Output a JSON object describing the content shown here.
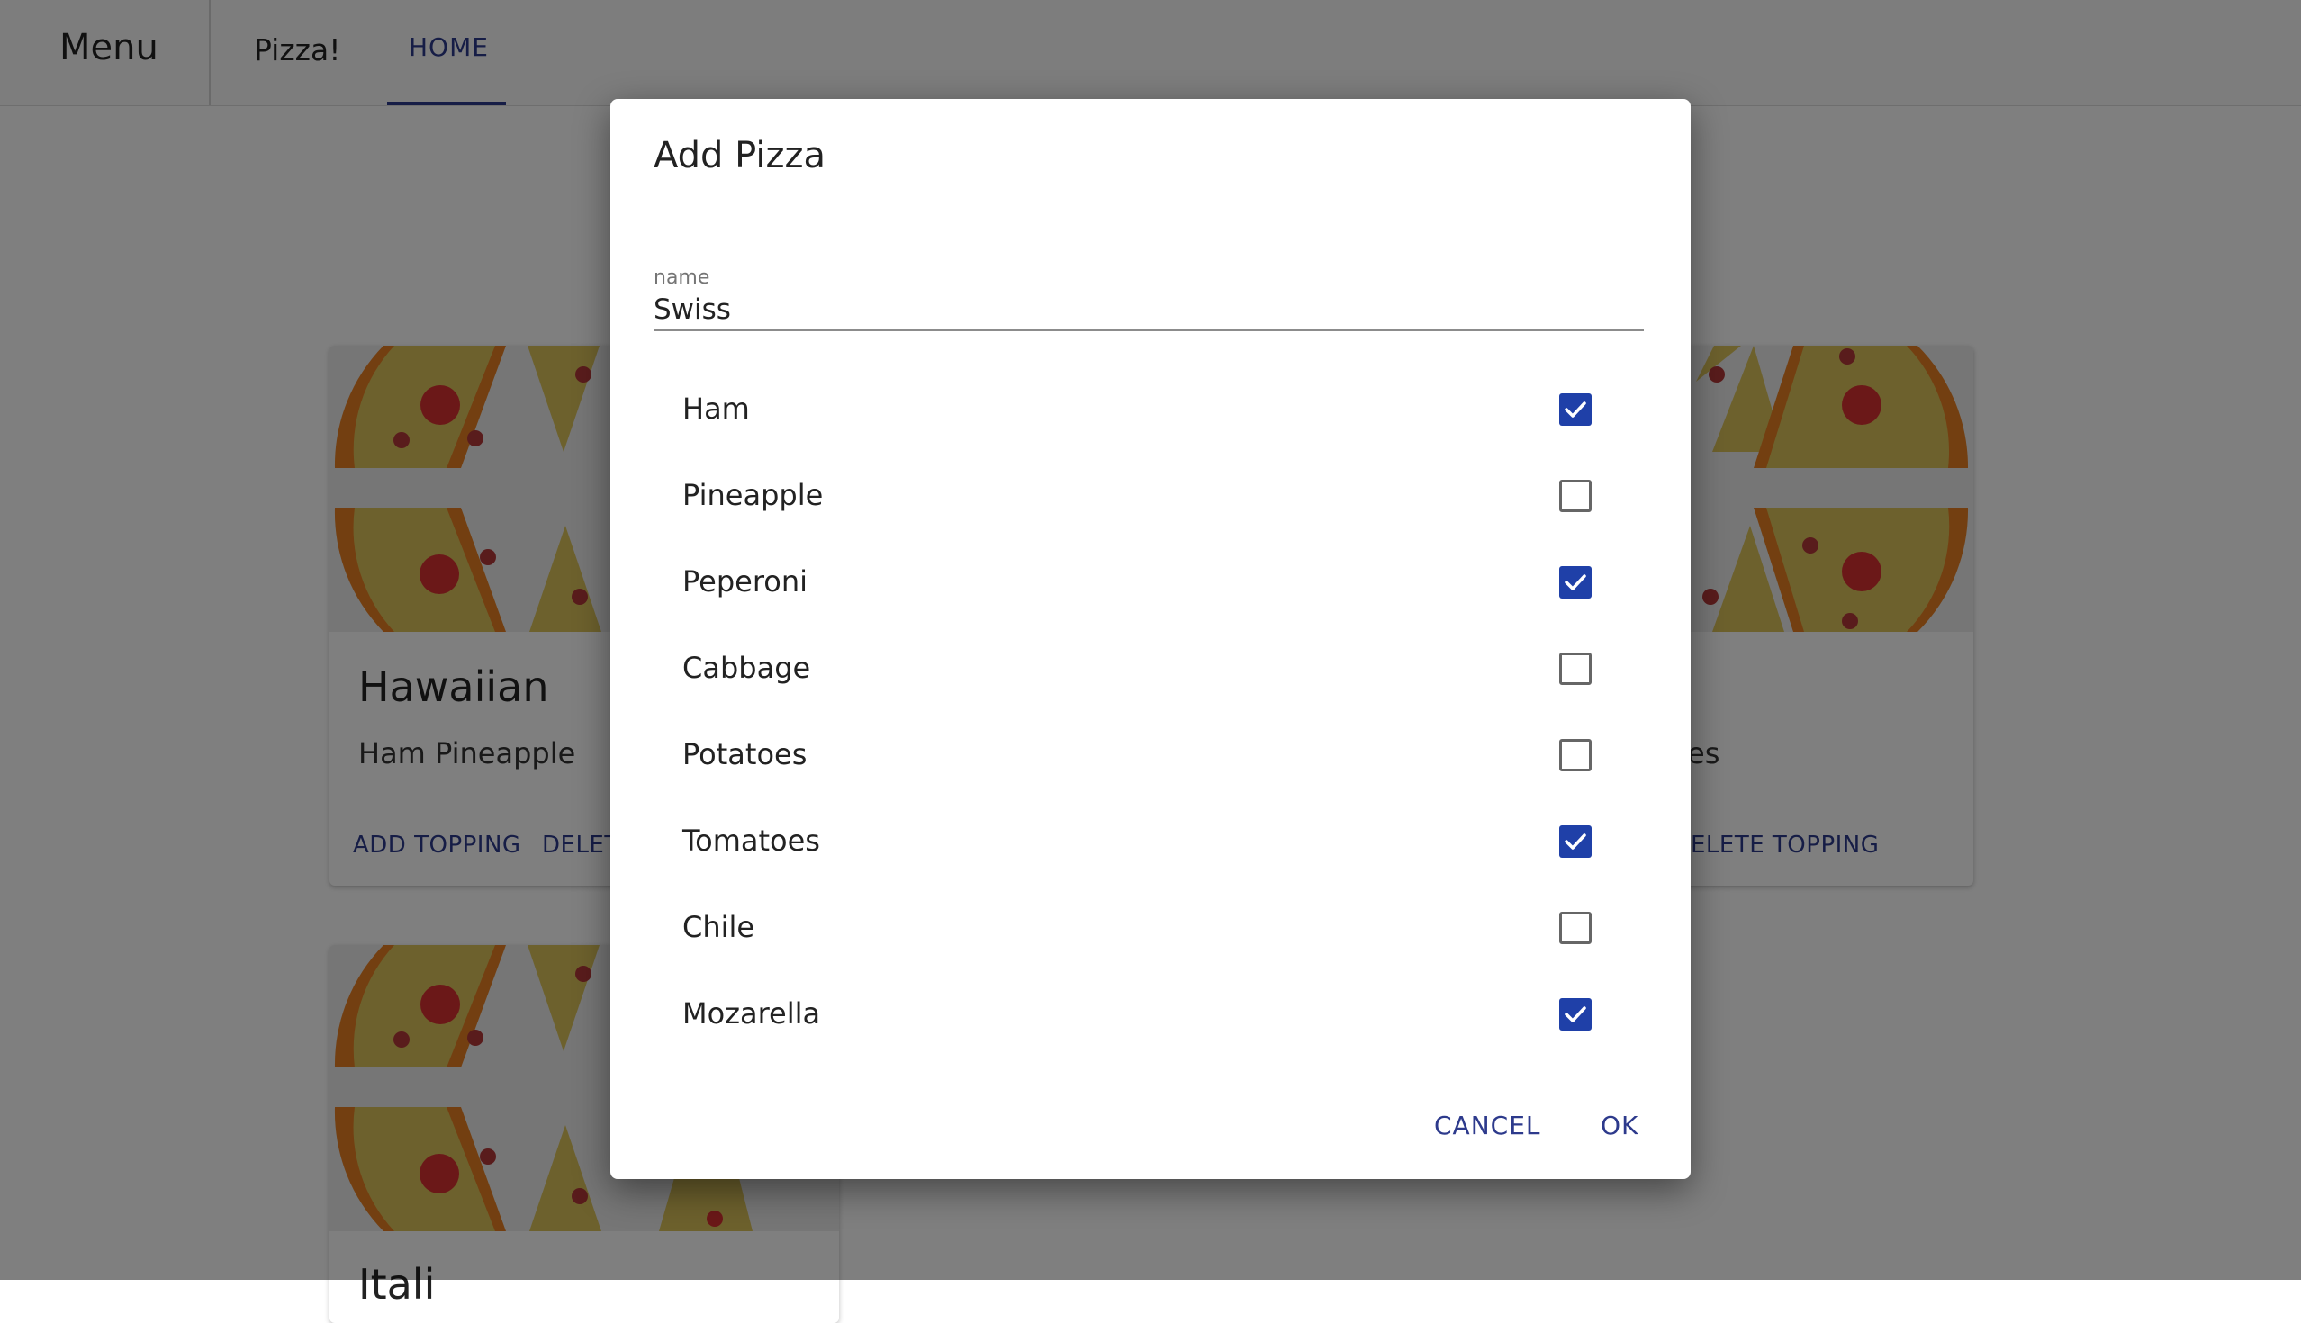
{
  "header": {
    "menu_label": "Menu",
    "app_name": "Pizza!",
    "tabs": [
      {
        "label": "HOME",
        "active": true
      }
    ]
  },
  "cards": [
    {
      "title": "Hawaiian",
      "description": "Ham Pineapple",
      "add_label": "ADD TOPPING",
      "delete_label": "DELETE TOPPING"
    },
    {
      "title": "",
      "description": "es",
      "add_label": "",
      "delete_label": "ELETE TOPPING"
    },
    {
      "title": "Itali",
      "description": "",
      "add_label": "",
      "delete_label": ""
    }
  ],
  "dialog": {
    "title": "Add Pizza",
    "name_field": {
      "label": "name",
      "value": "Swiss"
    },
    "toppings": [
      {
        "label": "Ham",
        "checked": true
      },
      {
        "label": "Pineapple",
        "checked": false
      },
      {
        "label": "Peperoni",
        "checked": true
      },
      {
        "label": "Cabbage",
        "checked": false
      },
      {
        "label": "Potatoes",
        "checked": false
      },
      {
        "label": "Tomatoes",
        "checked": true
      },
      {
        "label": "Chile",
        "checked": false
      },
      {
        "label": "Mozarella",
        "checked": true
      }
    ],
    "cancel_label": "CANCEL",
    "ok_label": "OK"
  },
  "colors": {
    "accent": "#2d3a8c",
    "checkbox_checked": "#1f40a8",
    "scrim": "rgba(0,0,0,0.5)"
  },
  "icons": {
    "card_image": "pizza-slices-image",
    "checkbox_mark": "check-icon"
  }
}
